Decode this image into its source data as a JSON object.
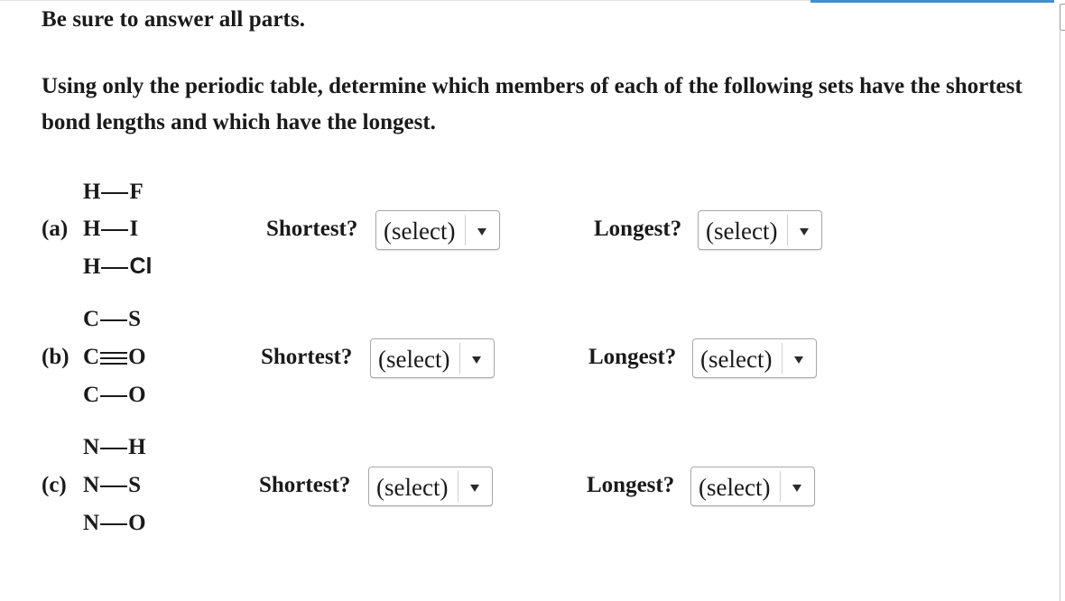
{
  "instruction": "Be sure to answer all parts.",
  "question": "Using only the periodic table, determine which members of each of the following sets have the shortest bond lengths and which have the longest.",
  "parts": [
    {
      "letter": "(a)",
      "molecules": [
        {
          "a": "H",
          "b": "F",
          "order": 1
        },
        {
          "a": "H",
          "b": "I",
          "order": 1
        },
        {
          "a": "H",
          "b": "Cl",
          "order": 1
        }
      ],
      "shortest_label": "Shortest?",
      "shortest_value": "(select)",
      "longest_label": "Longest?",
      "longest_value": "(select)"
    },
    {
      "letter": "(b)",
      "molecules": [
        {
          "a": "C",
          "b": "S",
          "order": 1
        },
        {
          "a": "C",
          "b": "O",
          "order": 3
        },
        {
          "a": "C",
          "b": "O",
          "order": 1
        }
      ],
      "shortest_label": "Shortest?",
      "shortest_value": "(select)",
      "longest_label": "Longest?",
      "longest_value": "(select)"
    },
    {
      "letter": "(c)",
      "molecules": [
        {
          "a": "N",
          "b": "H",
          "order": 1
        },
        {
          "a": "N",
          "b": "S",
          "order": 1
        },
        {
          "a": "N",
          "b": "O",
          "order": 1
        }
      ],
      "shortest_label": "Shortest?",
      "shortest_value": "(select)",
      "longest_label": "Longest?",
      "longest_value": "(select)"
    }
  ],
  "colors": {
    "accent": "#3d8fd6",
    "text": "#1a1a1a",
    "select_border": "#a8a8a8"
  }
}
